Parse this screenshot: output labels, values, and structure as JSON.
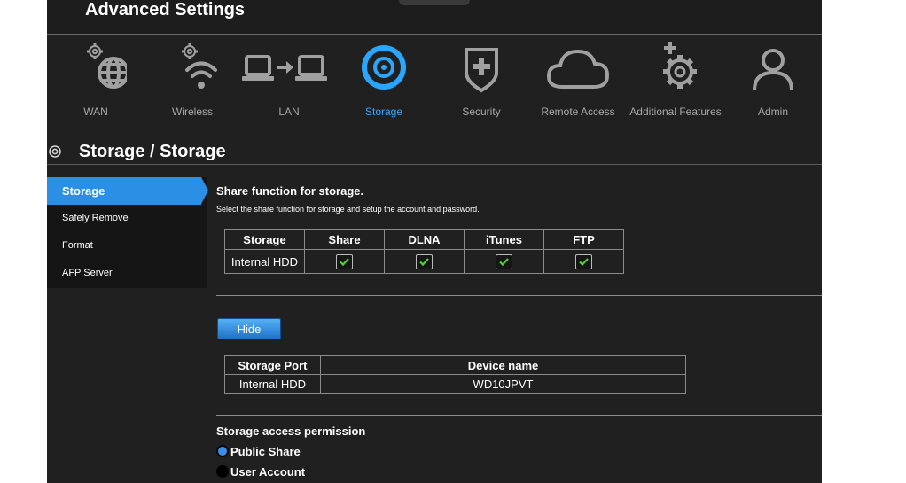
{
  "app": {
    "title": "Advanced Settings"
  },
  "nav": {
    "items": [
      {
        "label": "WAN",
        "icon": "globe-gear-icon"
      },
      {
        "label": "Wireless",
        "icon": "wifi-gear-icon"
      },
      {
        "label": "LAN",
        "icon": "lan-computers-icon"
      },
      {
        "label": "Storage",
        "icon": "storage-disc-icon",
        "active": true
      },
      {
        "label": "Security",
        "icon": "shield-plus-icon"
      },
      {
        "label": "Remote Access",
        "icon": "cloud-icon"
      },
      {
        "label": "Additional Features",
        "icon": "gear-plus-icon"
      },
      {
        "label": "Admin",
        "icon": "user-icon"
      }
    ]
  },
  "header": {
    "title": "Storage / Storage"
  },
  "sidebar": {
    "items": [
      {
        "label": "Storage",
        "active": true
      },
      {
        "label": "Safely Remove"
      },
      {
        "label": "Format"
      },
      {
        "label": "AFP Server"
      }
    ]
  },
  "share": {
    "heading": "Share function for storage.",
    "description": "Select the share function for storage and setup the account and password.",
    "columns": [
      "Storage",
      "Share",
      "DLNA",
      "iTunes",
      "FTP"
    ],
    "rows": [
      {
        "storage": "Internal HDD",
        "share": true,
        "dlna": true,
        "itunes": true,
        "ftp": true
      }
    ]
  },
  "hide_button": {
    "label": "Hide"
  },
  "ports": {
    "columns": [
      "Storage Port",
      "Device name"
    ],
    "rows": [
      {
        "port": "Internal HDD",
        "device": "WD10JPVT"
      }
    ]
  },
  "permission": {
    "heading": "Storage access permission",
    "options": [
      {
        "label": "Public Share",
        "selected": true
      },
      {
        "label": "User Account",
        "selected": false
      }
    ]
  },
  "colors": {
    "accent": "#3aa6ff",
    "active_tab": "#2c8fe6",
    "background": "#202020",
    "checkmark": "#4cd137"
  }
}
